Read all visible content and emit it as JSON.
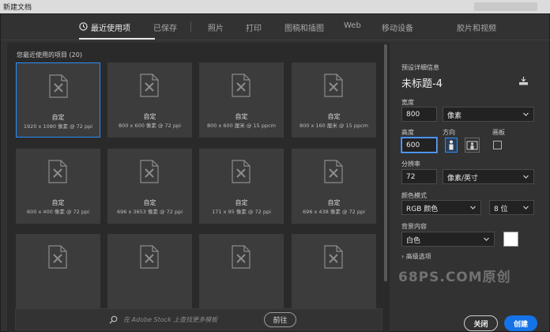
{
  "window": {
    "title": "新建文档"
  },
  "tabs": [
    {
      "label": "最近使用项"
    },
    {
      "label": "已保存"
    },
    {
      "label": "照片"
    },
    {
      "label": "打印"
    },
    {
      "label": "图稿和插图"
    },
    {
      "label": "Web"
    },
    {
      "label": "移动设备"
    },
    {
      "label": "胶片和视频"
    }
  ],
  "recent": {
    "title": "您最近使用的项目",
    "count": "(20)",
    "items": [
      {
        "name": "自定",
        "size": "1920 x 1080 像素 @ 72 ppi",
        "selected": true
      },
      {
        "name": "自定",
        "size": "800 x 600 像素 @ 72 ppi"
      },
      {
        "name": "自定",
        "size": "800 x 600 厘米 @ 15 ppcm"
      },
      {
        "name": "自定",
        "size": "800 x 160 厘米 @ 15 ppcm"
      },
      {
        "name": "自定",
        "size": "600 x 400 像素 @ 72 ppi"
      },
      {
        "name": "自定",
        "size": "696 x 3653 像素 @ 72 ppi"
      },
      {
        "name": "自定",
        "size": "171 x 95 像素 @ 72 ppi"
      },
      {
        "name": "自定",
        "size": "696 x 438 像素 @ 72 ppi"
      },
      {
        "name": "",
        "size": ""
      },
      {
        "name": "",
        "size": ""
      },
      {
        "name": "",
        "size": ""
      },
      {
        "name": "",
        "size": ""
      }
    ]
  },
  "stock": {
    "placeholder": "在 Adobe Stock 上查找更多模板",
    "go_label": "前往"
  },
  "details": {
    "header": "预设详细信息",
    "doc_name": "未标题-4",
    "width_label": "宽度",
    "width_value": "800",
    "width_unit": "像素",
    "height_label": "高度",
    "height_value": "600",
    "orientation_label": "方向",
    "artboard_label": "画板",
    "resolution_label": "分辨率",
    "resolution_value": "72",
    "resolution_unit": "像素/英寸",
    "color_mode_label": "颜色模式",
    "color_mode_value": "RGB 颜色",
    "bit_depth_value": "8 位",
    "background_label": "背景内容",
    "background_value": "白色",
    "background_color": "#ffffff",
    "advanced_label": "高级选项"
  },
  "buttons": {
    "close_label": "关闭",
    "create_label": "创建"
  },
  "watermark": "68PS.COM原创",
  "colors": {
    "accent": "#1473e6",
    "selection": "#2c8ef8"
  }
}
